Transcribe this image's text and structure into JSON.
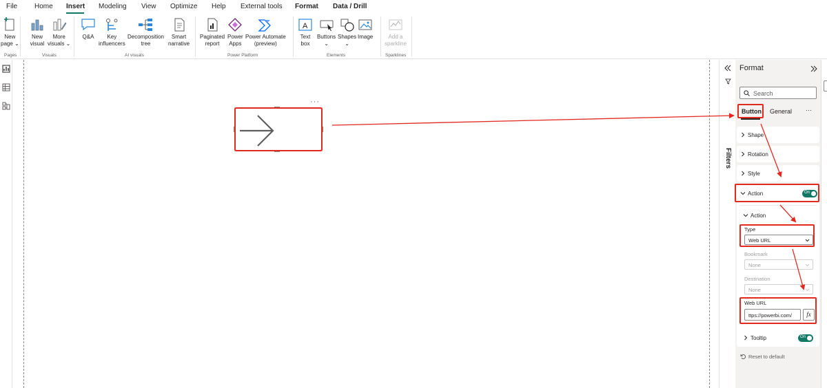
{
  "menu": {
    "items": [
      "File",
      "Home",
      "Insert",
      "Modeling",
      "View",
      "Optimize",
      "Help",
      "External tools",
      "Format",
      "Data / Drill"
    ]
  },
  "ribbon": {
    "new_page": [
      "New",
      "page ⌄"
    ],
    "pages_group": "Pages",
    "new_visual": [
      "New",
      "visual"
    ],
    "more_visuals": [
      "More",
      "visuals ⌄"
    ],
    "visuals_group": "Visuals",
    "qa": "Q&A",
    "key_influencers": [
      "Key",
      "influencers"
    ],
    "decomposition_tree": [
      "Decomposition",
      "tree"
    ],
    "smart_narrative": [
      "Smart",
      "narrative"
    ],
    "ai_group": "AI visuals",
    "paginated_report": [
      "Paginated",
      "report"
    ],
    "power_apps": [
      "Power",
      "Apps"
    ],
    "power_automate": [
      "Power Automate",
      "(preview)"
    ],
    "power_platform_group": "Power Platform",
    "text_box": [
      "Text",
      "box"
    ],
    "buttons": [
      "Buttons",
      "⌄"
    ],
    "shapes": [
      "Shapes",
      "⌄"
    ],
    "image": "Image",
    "elements_group": "Elements",
    "add_sparkline": [
      "Add a",
      "sparkline"
    ],
    "sparklines_group": "Sparklines"
  },
  "canvas": {
    "visual_more": "···"
  },
  "filters": {
    "label": "Filters"
  },
  "format_pane": {
    "title": "Format",
    "search_placeholder": "Search",
    "tab_button": "Button",
    "tab_general": "General",
    "tab_more": "···",
    "shape": "Shape",
    "rotation": "Rotation",
    "style": "Style",
    "action": "Action",
    "action_toggle": "On",
    "action_sub": "Action",
    "type_label": "Type",
    "type_value": "Web URL",
    "bookmark_label": "Bookmark",
    "bookmark_value": "None",
    "destination_label": "Destination",
    "destination_value": "None",
    "web_url_label": "Web URL",
    "web_url_value": "ttps://powerbi.com/",
    "fx": "fx",
    "tooltip": "Tooltip",
    "tooltip_toggle": "On",
    "reset": "Reset to default"
  },
  "colors": {
    "accent": "#117865",
    "highlight": "#e3281e",
    "pane_bg": "#f3f2f1"
  }
}
